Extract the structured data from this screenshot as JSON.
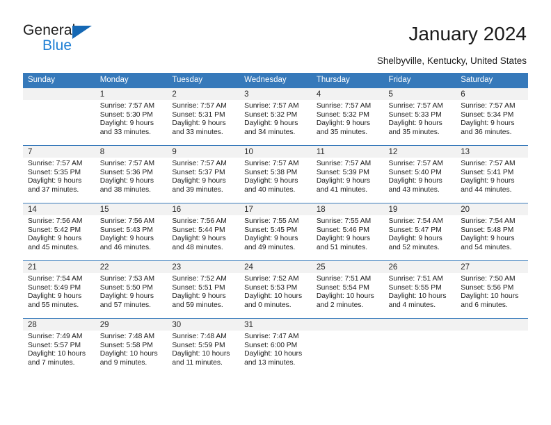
{
  "brand": {
    "name_top": "General",
    "name_bottom": "Blue",
    "accent_color": "#1568b4",
    "blue_text_color": "#1f7fd4"
  },
  "header": {
    "title": "January 2024",
    "subtitle": "Shelbyville, Kentucky, United States"
  },
  "calendar": {
    "header_bg": "#3679ba",
    "header_text_color": "#ffffff",
    "daynum_bg": "#f2f2f2",
    "row_border_color": "#3679ba",
    "weekdays": [
      "Sunday",
      "Monday",
      "Tuesday",
      "Wednesday",
      "Thursday",
      "Friday",
      "Saturday"
    ],
    "weeks": [
      [
        {
          "day": "",
          "sunrise": "",
          "sunset": "",
          "daylight_1": "",
          "daylight_2": ""
        },
        {
          "day": "1",
          "sunrise": "Sunrise: 7:57 AM",
          "sunset": "Sunset: 5:30 PM",
          "daylight_1": "Daylight: 9 hours",
          "daylight_2": "and 33 minutes."
        },
        {
          "day": "2",
          "sunrise": "Sunrise: 7:57 AM",
          "sunset": "Sunset: 5:31 PM",
          "daylight_1": "Daylight: 9 hours",
          "daylight_2": "and 33 minutes."
        },
        {
          "day": "3",
          "sunrise": "Sunrise: 7:57 AM",
          "sunset": "Sunset: 5:32 PM",
          "daylight_1": "Daylight: 9 hours",
          "daylight_2": "and 34 minutes."
        },
        {
          "day": "4",
          "sunrise": "Sunrise: 7:57 AM",
          "sunset": "Sunset: 5:32 PM",
          "daylight_1": "Daylight: 9 hours",
          "daylight_2": "and 35 minutes."
        },
        {
          "day": "5",
          "sunrise": "Sunrise: 7:57 AM",
          "sunset": "Sunset: 5:33 PM",
          "daylight_1": "Daylight: 9 hours",
          "daylight_2": "and 35 minutes."
        },
        {
          "day": "6",
          "sunrise": "Sunrise: 7:57 AM",
          "sunset": "Sunset: 5:34 PM",
          "daylight_1": "Daylight: 9 hours",
          "daylight_2": "and 36 minutes."
        }
      ],
      [
        {
          "day": "7",
          "sunrise": "Sunrise: 7:57 AM",
          "sunset": "Sunset: 5:35 PM",
          "daylight_1": "Daylight: 9 hours",
          "daylight_2": "and 37 minutes."
        },
        {
          "day": "8",
          "sunrise": "Sunrise: 7:57 AM",
          "sunset": "Sunset: 5:36 PM",
          "daylight_1": "Daylight: 9 hours",
          "daylight_2": "and 38 minutes."
        },
        {
          "day": "9",
          "sunrise": "Sunrise: 7:57 AM",
          "sunset": "Sunset: 5:37 PM",
          "daylight_1": "Daylight: 9 hours",
          "daylight_2": "and 39 minutes."
        },
        {
          "day": "10",
          "sunrise": "Sunrise: 7:57 AM",
          "sunset": "Sunset: 5:38 PM",
          "daylight_1": "Daylight: 9 hours",
          "daylight_2": "and 40 minutes."
        },
        {
          "day": "11",
          "sunrise": "Sunrise: 7:57 AM",
          "sunset": "Sunset: 5:39 PM",
          "daylight_1": "Daylight: 9 hours",
          "daylight_2": "and 41 minutes."
        },
        {
          "day": "12",
          "sunrise": "Sunrise: 7:57 AM",
          "sunset": "Sunset: 5:40 PM",
          "daylight_1": "Daylight: 9 hours",
          "daylight_2": "and 43 minutes."
        },
        {
          "day": "13",
          "sunrise": "Sunrise: 7:57 AM",
          "sunset": "Sunset: 5:41 PM",
          "daylight_1": "Daylight: 9 hours",
          "daylight_2": "and 44 minutes."
        }
      ],
      [
        {
          "day": "14",
          "sunrise": "Sunrise: 7:56 AM",
          "sunset": "Sunset: 5:42 PM",
          "daylight_1": "Daylight: 9 hours",
          "daylight_2": "and 45 minutes."
        },
        {
          "day": "15",
          "sunrise": "Sunrise: 7:56 AM",
          "sunset": "Sunset: 5:43 PM",
          "daylight_1": "Daylight: 9 hours",
          "daylight_2": "and 46 minutes."
        },
        {
          "day": "16",
          "sunrise": "Sunrise: 7:56 AM",
          "sunset": "Sunset: 5:44 PM",
          "daylight_1": "Daylight: 9 hours",
          "daylight_2": "and 48 minutes."
        },
        {
          "day": "17",
          "sunrise": "Sunrise: 7:55 AM",
          "sunset": "Sunset: 5:45 PM",
          "daylight_1": "Daylight: 9 hours",
          "daylight_2": "and 49 minutes."
        },
        {
          "day": "18",
          "sunrise": "Sunrise: 7:55 AM",
          "sunset": "Sunset: 5:46 PM",
          "daylight_1": "Daylight: 9 hours",
          "daylight_2": "and 51 minutes."
        },
        {
          "day": "19",
          "sunrise": "Sunrise: 7:54 AM",
          "sunset": "Sunset: 5:47 PM",
          "daylight_1": "Daylight: 9 hours",
          "daylight_2": "and 52 minutes."
        },
        {
          "day": "20",
          "sunrise": "Sunrise: 7:54 AM",
          "sunset": "Sunset: 5:48 PM",
          "daylight_1": "Daylight: 9 hours",
          "daylight_2": "and 54 minutes."
        }
      ],
      [
        {
          "day": "21",
          "sunrise": "Sunrise: 7:54 AM",
          "sunset": "Sunset: 5:49 PM",
          "daylight_1": "Daylight: 9 hours",
          "daylight_2": "and 55 minutes."
        },
        {
          "day": "22",
          "sunrise": "Sunrise: 7:53 AM",
          "sunset": "Sunset: 5:50 PM",
          "daylight_1": "Daylight: 9 hours",
          "daylight_2": "and 57 minutes."
        },
        {
          "day": "23",
          "sunrise": "Sunrise: 7:52 AM",
          "sunset": "Sunset: 5:51 PM",
          "daylight_1": "Daylight: 9 hours",
          "daylight_2": "and 59 minutes."
        },
        {
          "day": "24",
          "sunrise": "Sunrise: 7:52 AM",
          "sunset": "Sunset: 5:53 PM",
          "daylight_1": "Daylight: 10 hours",
          "daylight_2": "and 0 minutes."
        },
        {
          "day": "25",
          "sunrise": "Sunrise: 7:51 AM",
          "sunset": "Sunset: 5:54 PM",
          "daylight_1": "Daylight: 10 hours",
          "daylight_2": "and 2 minutes."
        },
        {
          "day": "26",
          "sunrise": "Sunrise: 7:51 AM",
          "sunset": "Sunset: 5:55 PM",
          "daylight_1": "Daylight: 10 hours",
          "daylight_2": "and 4 minutes."
        },
        {
          "day": "27",
          "sunrise": "Sunrise: 7:50 AM",
          "sunset": "Sunset: 5:56 PM",
          "daylight_1": "Daylight: 10 hours",
          "daylight_2": "and 6 minutes."
        }
      ],
      [
        {
          "day": "28",
          "sunrise": "Sunrise: 7:49 AM",
          "sunset": "Sunset: 5:57 PM",
          "daylight_1": "Daylight: 10 hours",
          "daylight_2": "and 7 minutes."
        },
        {
          "day": "29",
          "sunrise": "Sunrise: 7:48 AM",
          "sunset": "Sunset: 5:58 PM",
          "daylight_1": "Daylight: 10 hours",
          "daylight_2": "and 9 minutes."
        },
        {
          "day": "30",
          "sunrise": "Sunrise: 7:48 AM",
          "sunset": "Sunset: 5:59 PM",
          "daylight_1": "Daylight: 10 hours",
          "daylight_2": "and 11 minutes."
        },
        {
          "day": "31",
          "sunrise": "Sunrise: 7:47 AM",
          "sunset": "Sunset: 6:00 PM",
          "daylight_1": "Daylight: 10 hours",
          "daylight_2": "and 13 minutes."
        },
        {
          "day": "",
          "sunrise": "",
          "sunset": "",
          "daylight_1": "",
          "daylight_2": ""
        },
        {
          "day": "",
          "sunrise": "",
          "sunset": "",
          "daylight_1": "",
          "daylight_2": ""
        },
        {
          "day": "",
          "sunrise": "",
          "sunset": "",
          "daylight_1": "",
          "daylight_2": ""
        }
      ]
    ]
  }
}
